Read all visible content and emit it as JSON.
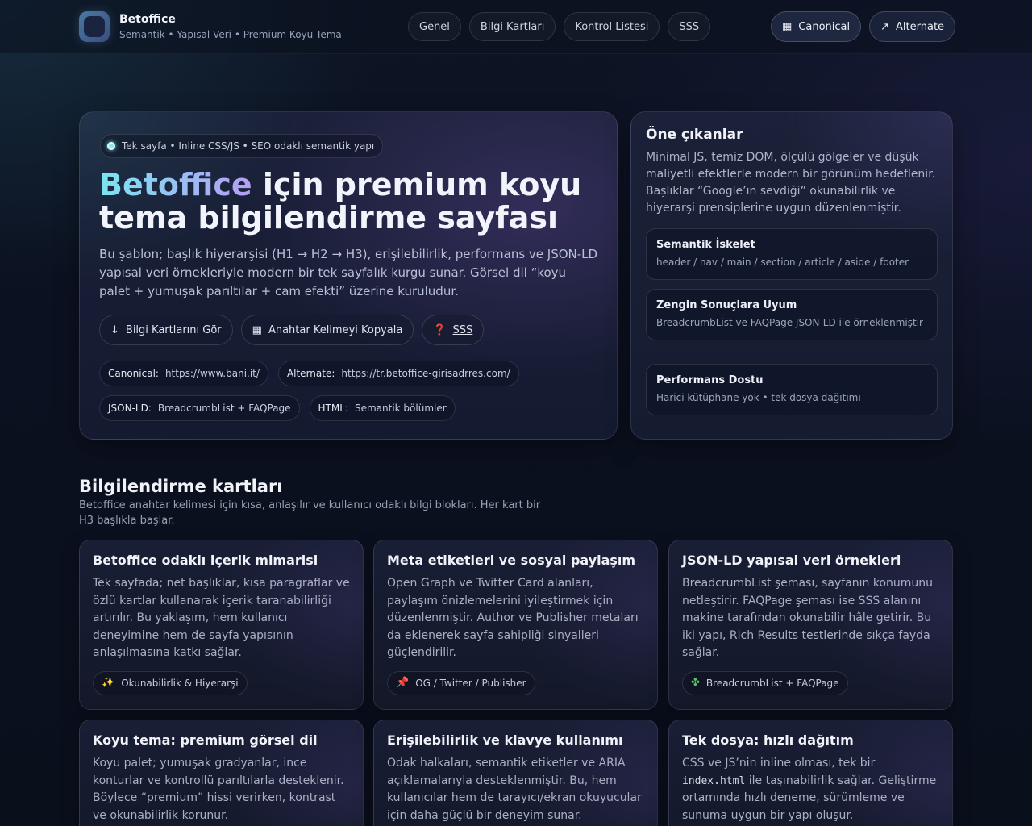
{
  "header": {
    "brand_name": "Betoffice",
    "brand_sub": "Semantik • Yapısal Veri • Premium Koyu Tema",
    "nav": [
      "Genel",
      "Bilgi Kartları",
      "Kontrol Listesi",
      "SSS"
    ],
    "canonical_label": "Canonical",
    "alternate_label": "Alternate"
  },
  "hero": {
    "badge": "Tek sayfa • Inline CSS/JS • SEO odaklı semantik yapı",
    "title_highlight": "Betoffice",
    "title_rest": " için premium koyu tema bilgilendirme sayfası",
    "lead": "Bu şablon; başlık hiyerarşisi (H1 → H2 → H3), erişilebilirlik, performans ve JSON-LD yapısal veri örnekleriyle modern bir tek sayfalık kurgu sunar. Görsel dil “koyu palet + yumuşak parıltılar + cam efekti” üzerine kuruludur.",
    "cta_cards": "Bilgi Kartlarını Gör",
    "cta_copy": "Anahtar Kelimeyi Kopyala",
    "cta_faq": "SSS",
    "chips": [
      {
        "k": "Canonical:",
        "v": "https://www.bani.it/"
      },
      {
        "k": "Alternate:",
        "v": "https://tr.betoffice-girisadrres.com/"
      },
      {
        "k": "JSON-LD:",
        "v": "BreadcrumbList + FAQPage"
      },
      {
        "k": "HTML:",
        "v": "Semantik bölümler"
      }
    ]
  },
  "aside": {
    "title": "Öne çıkanlar",
    "text": "Minimal JS, temiz DOM, ölçülü gölgeler ve düşük maliyetli efektlerle modern bir görünüm hedeflenir. Başlıklar “Google’ın sevdiği” okunabilirlik ve hiyerarşi prensiplerine uygun düzenlenmiştir.",
    "items": [
      {
        "title": "Semantik İskelet",
        "text": "header / nav / main / section / article / aside / footer"
      },
      {
        "title": "Zengin Sonuçlara Uyum",
        "text": "BreadcrumbList ve FAQPage JSON-LD ile örneklenmiştir"
      },
      {
        "title": "Performans Dostu",
        "text": "Harici kütüphane yok • tek dosya dağıtımı"
      }
    ]
  },
  "section": {
    "title": "Bilgilendirme kartları",
    "subtitle": "Betoffice anahtar kelimesi için kısa, anlaşılır ve kullanıcı odaklı bilgi blokları. Her kart bir H3 başlıkla başlar."
  },
  "cards": [
    {
      "title": "Betoffice odaklı içerik mimarisi",
      "text": "Tek sayfada; net başlıklar, kısa paragraflar ve özlü kartlar kullanarak içerik taranabilirliği artırılır. Bu yaklaşım, hem kullanıcı deneyimine hem de sayfa yapısının anlaşılmasına katkı sağlar.",
      "tag": "Okunabilirlik & Hiyerarşi"
    },
    {
      "title": "Meta etiketleri ve sosyal paylaşım",
      "text": "Open Graph ve Twitter Card alanları, paylaşım önizlemelerini iyileştirmek için düzenlenmiştir. Author ve Publisher metaları da eklenerek sayfa sahipliği sinyalleri güçlendirilir.",
      "tag": "OG / Twitter / Publisher"
    },
    {
      "title": "JSON-LD yapısal veri örnekleri",
      "text": "BreadcrumbList şeması, sayfanın konumunu netleştirir. FAQPage şeması ise SSS alanını makine tarafından okunabilir hâle getirir. Bu iki yapı, Rich Results testlerinde sıkça fayda sağlar.",
      "tag": "BreadcrumbList + FAQPage"
    },
    {
      "title": "Koyu tema: premium görsel dil",
      "text": "Koyu palet; yumuşak gradyanlar, ince konturlar ve kontrollü parıltılarla desteklenir. Böylece “premium” hissi verirken, kontrast ve okunabilirlik korunur."
    },
    {
      "title": "Erişilebilirlik ve klavye kullanımı",
      "text": "Odak halkaları, semantik etiketler ve ARIA açıklamalarıyla desteklenmiştir. Bu, hem kullanıcılar hem de tarayıcı/ekran okuyucular için daha güçlü bir deneyim sunar."
    },
    {
      "title": "Tek dosya: hızlı dağıtım",
      "text_a": "CSS ve JS’nin inline olması, tek bir ",
      "code": "index.html",
      "text_b": " ile taşınabilirlik sağlar. Geliştirme ortamında hızlı deneme, sürümleme ve sunuma uygun bir yapı oluşur."
    }
  ]
}
